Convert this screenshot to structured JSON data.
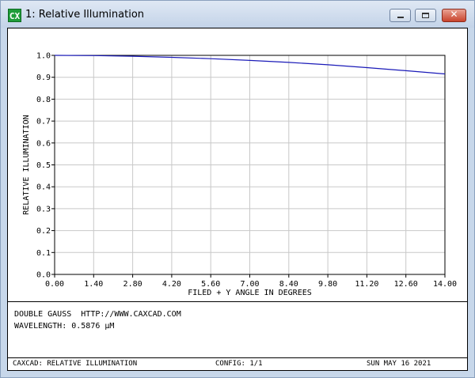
{
  "window": {
    "icon_text": "CX",
    "title": "1: Relative Illumination",
    "close_glyph": "✕"
  },
  "info": {
    "line1": "DOUBLE GAUSS  HTTP://WWW.CAXCAD.COM",
    "line2": "WAVELENGTH: 0.5876 µM"
  },
  "status": {
    "left": "CAXCAD: RELATIVE ILLUMINATION",
    "center": "CONFIG: 1/1",
    "right": "SUN MAY 16 2021"
  },
  "chart_data": {
    "type": "line",
    "title": "",
    "xlabel": "FILED + Y ANGLE IN DEGREES",
    "ylabel": "RELATIVE ILLUMINATION",
    "xlim": [
      0,
      14
    ],
    "ylim": [
      0,
      1
    ],
    "x_ticks": [
      "0.00",
      "1.40",
      "2.80",
      "4.20",
      "5.60",
      "7.00",
      "8.40",
      "9.80",
      "11.20",
      "12.60",
      "14.00"
    ],
    "y_ticks": [
      "0.0",
      "0.1",
      "0.2",
      "0.3",
      "0.4",
      "0.5",
      "0.6",
      "0.7",
      "0.8",
      "0.9",
      "1.0"
    ],
    "grid": true,
    "line_color": "#1a1ab8",
    "series": [
      {
        "x": [
          0,
          1.4,
          2.8,
          4.2,
          5.6,
          7.0,
          8.4,
          9.8,
          11.2,
          12.6,
          14.0
        ],
        "values": [
          1.0,
          0.999,
          0.996,
          0.991,
          0.985,
          0.977,
          0.968,
          0.957,
          0.944,
          0.93,
          0.915
        ]
      }
    ]
  }
}
